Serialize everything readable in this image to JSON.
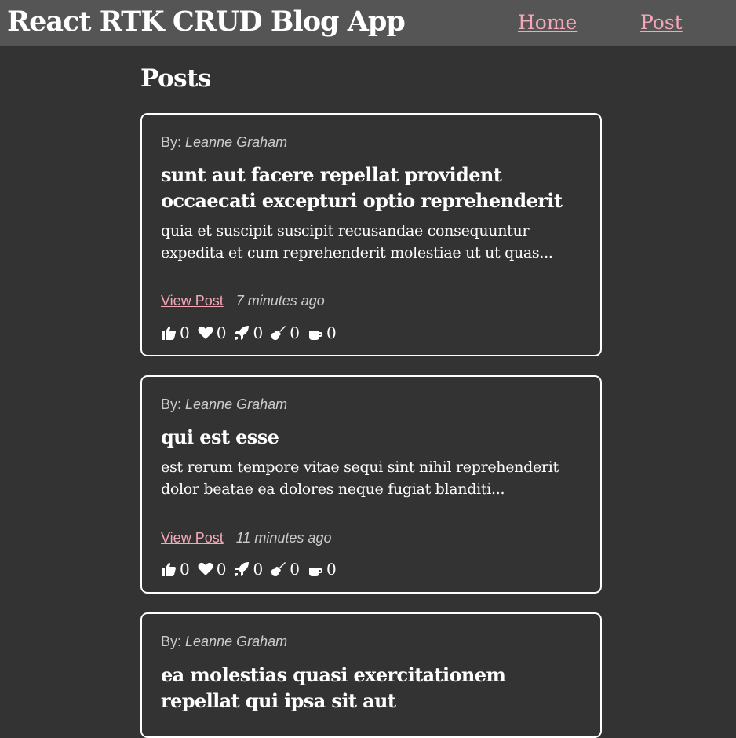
{
  "header": {
    "title": "React RTK CRUD Blog App",
    "nav": {
      "home": "Home",
      "post": "Post"
    }
  },
  "page_title": "Posts",
  "posts": [
    {
      "by_label": "By:",
      "author": "Leanne Graham",
      "title": "sunt aut facere repellat provident occaecati excepturi optio reprehenderit",
      "body": "quia et suscipit suscipit recusandae consequuntur expedita et cum reprehenderit molestiae ut ut quas...",
      "view_label": "View Post",
      "time_ago": "7 minutes ago",
      "reactions": {
        "thumbs_up": "0",
        "heart": "0",
        "rocket": "0",
        "guitar": "0",
        "coffee": "0"
      }
    },
    {
      "by_label": "By:",
      "author": "Leanne Graham",
      "title": "qui est esse",
      "body": "est rerum tempore vitae sequi sint nihil reprehenderit dolor beatae ea dolores neque fugiat blanditi...",
      "view_label": "View Post",
      "time_ago": "11 minutes ago",
      "reactions": {
        "thumbs_up": "0",
        "heart": "0",
        "rocket": "0",
        "guitar": "0",
        "coffee": "0"
      }
    },
    {
      "by_label": "By:",
      "author": "Leanne Graham",
      "title": "ea molestias quasi exercitationem repellat qui ipsa sit aut"
    }
  ],
  "colors": {
    "background": "#333333",
    "header": "#555555",
    "link": "#f4a7b9"
  }
}
